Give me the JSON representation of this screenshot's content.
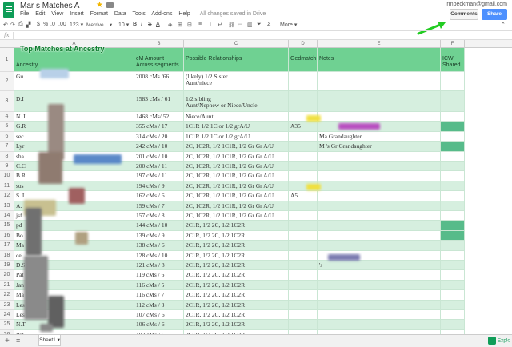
{
  "title_bar": {
    "doc_title": "Mar    s Matches A",
    "account_email": "rmbeckman@gmail.com",
    "comments_label": "Comments",
    "share_label": "Share"
  },
  "menu": {
    "items": [
      "File",
      "Edit",
      "View",
      "Insert",
      "Format",
      "Data",
      "Tools",
      "Add-ons",
      "Help"
    ],
    "save_status": "All changes saved in Drive"
  },
  "toolbar": {
    "currency": "$",
    "percent": "%",
    "dec_less": ".0",
    "dec_more": ".00",
    "number_format": "123 ▾",
    "font": "Merrive... ▾",
    "font_size": "10 ▾",
    "bold": "B",
    "italic": "I",
    "strike": "S",
    "text_color": "A",
    "more": "More ▾",
    "collapse": "⌃"
  },
  "formula_bar": {
    "fx": "fx"
  },
  "columns": [
    "A",
    "B",
    "C",
    "D",
    "E",
    "F"
  ],
  "header_row": {
    "title_overlay": "Top Matches at Ancestry",
    "ancestry": "Ancestry",
    "cm_amount": "cM Amount Across segments",
    "relationships": "Possible Relationships",
    "gedmatch": "Gedmatch",
    "notes": "Notes",
    "icw": "ICW Shared"
  },
  "rows": [
    {
      "num": "2",
      "name": "Gu",
      "cm": "2008 cMs /66",
      "rel": "(likely) 1/2 Sister\nAunt/niece",
      "ged": "",
      "notes": "",
      "icw": false,
      "green": false
    },
    {
      "num": "3",
      "name": "D.I",
      "cm": "1583 cMs / 61",
      "rel": "1/2 sibling\nAunt/Nephew or Niece/Uncle",
      "ged": "",
      "notes": "",
      "icw": false,
      "green": true
    },
    {
      "num": "4",
      "name": "N. I",
      "cm": "1468 cMs/ 52",
      "rel": "Niece/Aunt",
      "ged": "",
      "notes": "",
      "icw": false,
      "green": false
    },
    {
      "num": "5",
      "name": "G.R",
      "cm": "355 cMs / 17",
      "rel": "1C1R 1/2 1C or 1/2 grA/U",
      "ged": "A35",
      "notes": "",
      "icw": true,
      "green": true
    },
    {
      "num": "6",
      "name": "sec",
      "cm": "314 cMs / 20",
      "rel": "1C1R 1/2 1C or 1/2 grA/U",
      "ged": "",
      "notes": "Ma                   Grandaughter",
      "icw": false,
      "green": false
    },
    {
      "num": "7",
      "name": "Lyr",
      "cm": "242 cMs / 10",
      "rel": "2C, 1C2R, 1/2 1C1R, 1/2 Gr Gr A/U",
      "ged": "",
      "notes": "M        's Gr Grandaughter",
      "icw": true,
      "green": true
    },
    {
      "num": "8",
      "name": "sha",
      "cm": "201 cMs / 10",
      "rel": "2C, 1C2R, 1/2 1C1R, 1/2 Gr Gr A/U",
      "ged": "",
      "notes": "",
      "icw": false,
      "green": false
    },
    {
      "num": "9",
      "name": "C.C",
      "cm": "200 cMs / 11",
      "rel": "2C, 1C2R, 1/2 1C1R, 1/2 Gr Gr A/U",
      "ged": "",
      "notes": "",
      "icw": false,
      "green": true
    },
    {
      "num": "10",
      "name": "B.R",
      "cm": "197 cMs / 11",
      "rel": "2C, 1C2R, 1/2 1C1R, 1/2 Gr Gr A/U",
      "ged": "",
      "notes": "",
      "icw": false,
      "green": false
    },
    {
      "num": "11",
      "name": "sus",
      "cm": "194 cMs / 9",
      "rel": "2C, 1C2R, 1/2 1C1R, 1/2 Gr Gr A/U",
      "ged": "",
      "notes": "",
      "icw": false,
      "green": true
    },
    {
      "num": "12",
      "name": "S. I",
      "cm": "162 cMs / 6",
      "rel": "2C, 1C2R, 1/2 1C1R, 1/2 Gr Gr A/U",
      "ged": "A5",
      "notes": "",
      "icw": false,
      "green": false
    },
    {
      "num": "13",
      "name": "A.",
      "cm": "159 cMs / 7",
      "rel": "2C, 1C2R, 1/2 1C1R, 1/2 Gr Gr A/U",
      "ged": "",
      "notes": "",
      "icw": false,
      "green": true
    },
    {
      "num": "14",
      "name": "jsf",
      "cm": "157 cMs / 8",
      "rel": "2C, 1C2R, 1/2 1C1R, 1/2 Gr Gr A/U",
      "ged": "",
      "notes": "",
      "icw": false,
      "green": false
    },
    {
      "num": "15",
      "name": "pd",
      "cm": "144 cMs / 10",
      "rel": "2C1R, 1/2 2C, 1/2 1C2R",
      "ged": "",
      "notes": "",
      "icw": true,
      "green": true
    },
    {
      "num": "16",
      "name": "Bo",
      "cm": "139 cMs / 9",
      "rel": "2C1R, 1/2 2C, 1/2 1C2R",
      "ged": "",
      "notes": "",
      "icw": true,
      "green": false
    },
    {
      "num": "17",
      "name": "Ma",
      "cm": "138 cMs / 6",
      "rel": "2C1R, 1/2 2C, 1/2 1C2R",
      "ged": "",
      "notes": "",
      "icw": false,
      "green": true
    },
    {
      "num": "18",
      "name": "cel",
      "cm": "128 cMs / 10",
      "rel": "2C1R, 1/2 2C, 1/2 1C2R",
      "ged": "",
      "notes": "",
      "icw": false,
      "green": false
    },
    {
      "num": "19",
      "name": "D.S",
      "cm": "121 cMs / 8",
      "rel": "2C1R, 1/2 2C, 1/2 1C2R",
      "ged": "",
      "notes": "'s",
      "icw": false,
      "green": true
    },
    {
      "num": "20",
      "name": "Pat",
      "cm": "119 cMs / 6",
      "rel": "2C1R, 1/2 2C, 1/2 1C2R",
      "ged": "",
      "notes": "",
      "icw": false,
      "green": false
    },
    {
      "num": "21",
      "name": "Jan",
      "cm": "116 cMs / 5",
      "rel": "2C1R, 1/2 2C, 1/2 1C2R",
      "ged": "",
      "notes": "",
      "icw": false,
      "green": true
    },
    {
      "num": "22",
      "name": "Ma",
      "cm": "116 cMs / 7",
      "rel": "2C1R, 1/2 2C, 1/2 1C2R",
      "ged": "",
      "notes": "",
      "icw": false,
      "green": false
    },
    {
      "num": "23",
      "name": "Les",
      "cm": "112 cMs / 3",
      "rel": "2C1R, 1/2 2C, 1/2 1C2R",
      "ged": "",
      "notes": "",
      "icw": false,
      "green": true
    },
    {
      "num": "24",
      "name": "Les",
      "cm": "107 cMs / 6",
      "rel": "2C1R, 1/2 2C, 1/2 1C2R",
      "ged": "",
      "notes": "",
      "icw": false,
      "green": false
    },
    {
      "num": "25",
      "name": "N.T",
      "cm": "106 cMs / 6",
      "rel": "2C1R, 1/2 2C, 1/2 1C2R",
      "ged": "",
      "notes": "",
      "icw": false,
      "green": true
    },
    {
      "num": "26",
      "name": "Pat",
      "cm": "103 cMs / 6",
      "rel": "2C1R, 1/2 2C, 1/2 1C2R",
      "ged": "",
      "notes": "",
      "icw": false,
      "green": false
    }
  ],
  "bottom_bar": {
    "add_sheet": "+",
    "all_sheets": "≡",
    "sheet_tab": "Sheet1 ▾",
    "explore": "Explo"
  },
  "colors": {
    "header_green": "#6fd192",
    "band_green": "#d6efdf",
    "icw_green": "#57bb8a",
    "share_blue": "#4d90fe",
    "annotation_arrow": "#22cc22"
  }
}
